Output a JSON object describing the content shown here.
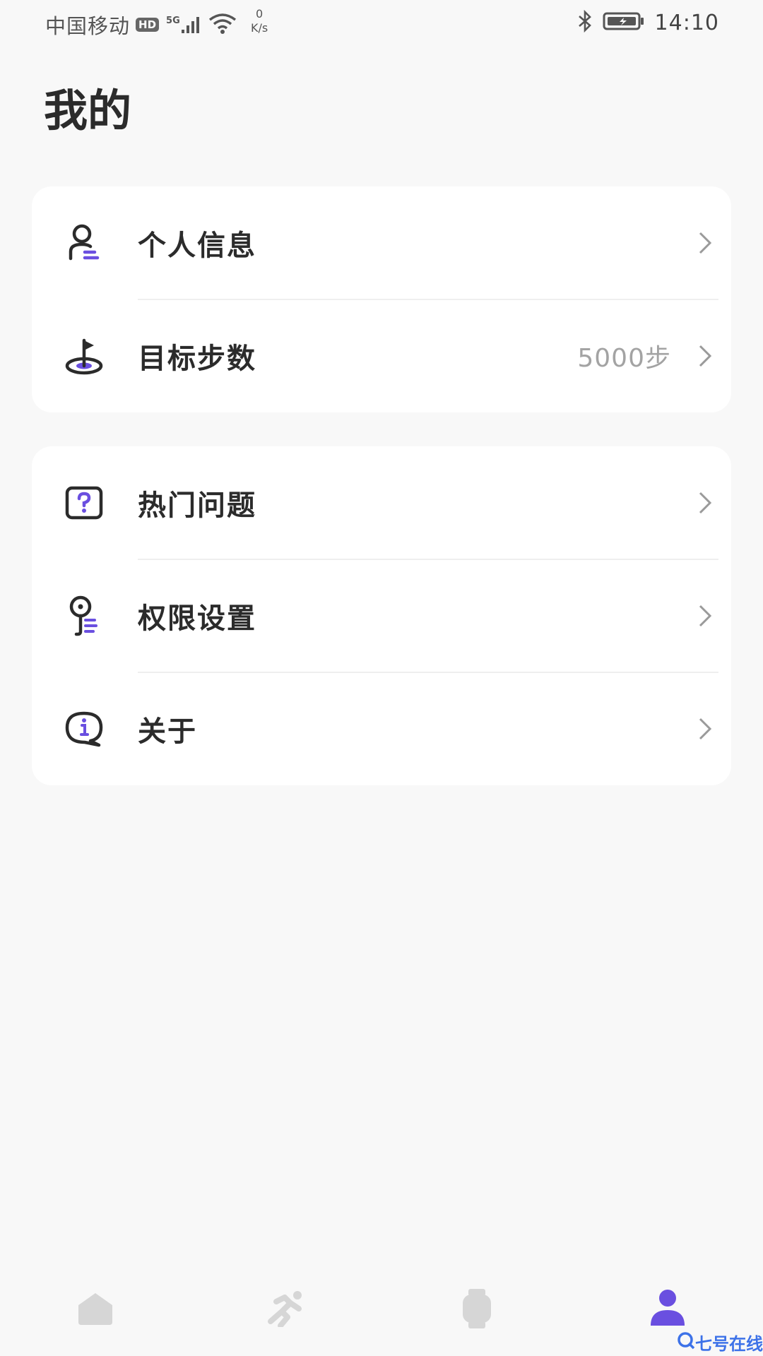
{
  "status_bar": {
    "carrier": "中国移动",
    "hd": "HD",
    "network": "5G",
    "speed_value": "0",
    "speed_unit": "K/s",
    "time": "14:10"
  },
  "page": {
    "title": "我的"
  },
  "card1": {
    "items": [
      {
        "label": "个人信息",
        "icon": "person-icon"
      },
      {
        "label": "目标步数",
        "value": "5000步",
        "icon": "goal-flag-icon"
      }
    ]
  },
  "card2": {
    "items": [
      {
        "label": "热门问题",
        "icon": "question-icon"
      },
      {
        "label": "权限设置",
        "icon": "key-icon"
      },
      {
        "label": "关于",
        "icon": "info-icon"
      }
    ]
  },
  "tabbar": {
    "tabs": [
      {
        "icon": "home-icon",
        "active": false
      },
      {
        "icon": "sport-icon",
        "active": false
      },
      {
        "icon": "watch-icon",
        "active": false
      },
      {
        "icon": "profile-icon",
        "active": true
      }
    ]
  },
  "watermark": {
    "text": "七号在线"
  },
  "colors": {
    "accent": "#6a4fe0",
    "inactive_tab": "#d6d6d6",
    "chevron": "#9a9a9a"
  }
}
